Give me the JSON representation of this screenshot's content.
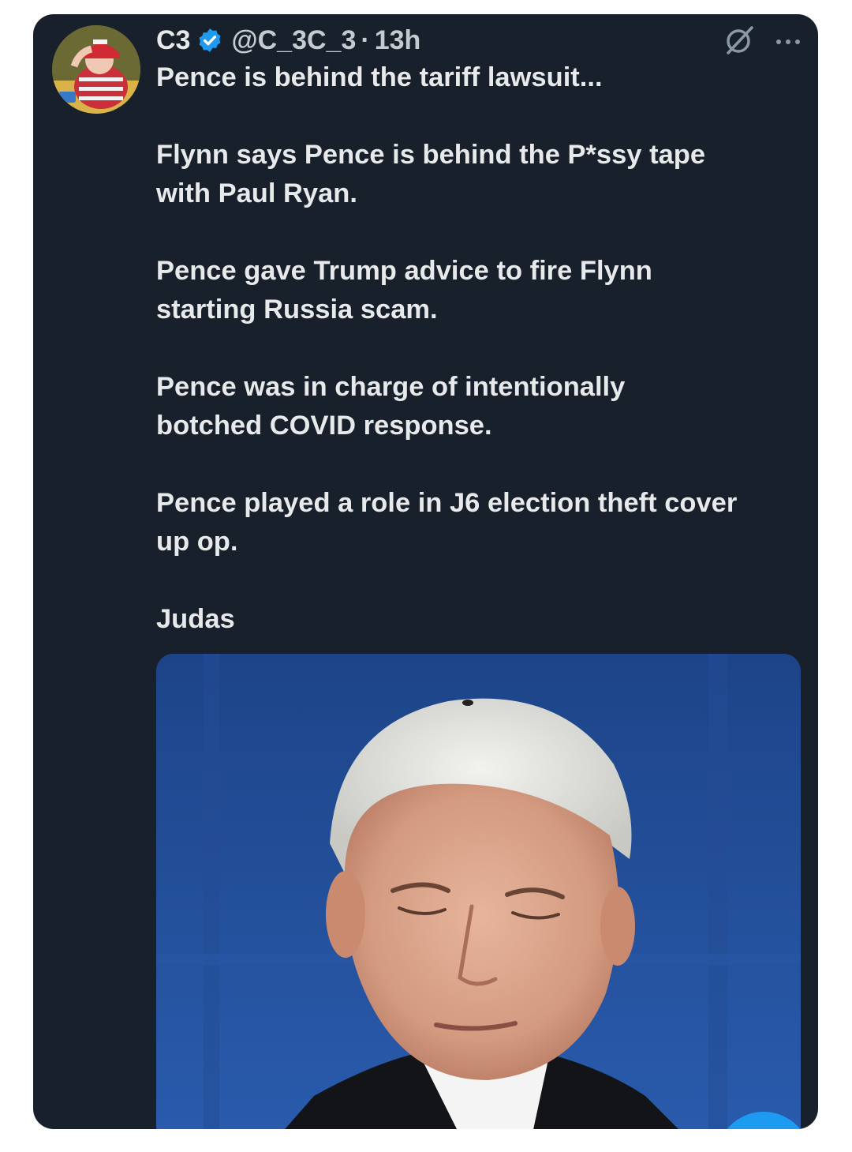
{
  "tweet": {
    "display_name": "C3",
    "handle": "@C_3C_3",
    "separator": "·",
    "time": "13h",
    "verified": true,
    "icons": {
      "verified": "verified-badge-icon",
      "grok": "grok-icon",
      "more": "more-icon"
    },
    "colors": {
      "card_bg": "#17202b",
      "text": "#e7e9ea",
      "muted": "#c5cad0",
      "verified": "#1d9bf0"
    },
    "paragraphs": [
      [
        "Pence is behind the tariff lawsuit..."
      ],
      [
        "Flynn says Pence is behind the P*ssy tape",
        "with Paul Ryan."
      ],
      [
        "Pence gave Trump advice to fire Flynn",
        "starting Russia scam."
      ],
      [
        "Pence was in charge of intentionally",
        "botched COVID response."
      ],
      [
        "Pence played a role in J6 election theft cover",
        "up op."
      ],
      [
        "Judas"
      ]
    ]
  }
}
